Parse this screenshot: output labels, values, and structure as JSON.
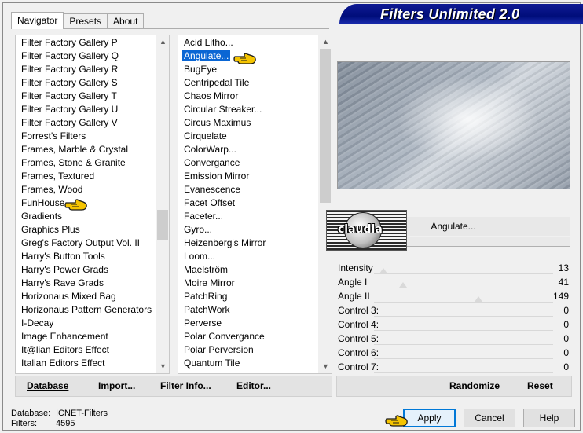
{
  "tabs": [
    {
      "label": "Navigator",
      "active": true
    },
    {
      "label": "Presets",
      "active": false
    },
    {
      "label": "About",
      "active": false
    }
  ],
  "title": "Filters Unlimited 2.0",
  "categories": {
    "items": [
      "Filter Factory Gallery P",
      "Filter Factory Gallery Q",
      "Filter Factory Gallery R",
      "Filter Factory Gallery S",
      "Filter Factory Gallery T",
      "Filter Factory Gallery U",
      "Filter Factory Gallery V",
      "Forrest's Filters",
      "Frames, Marble & Crystal",
      "Frames, Stone & Granite",
      "Frames, Textured",
      "Frames, Wood",
      "FunHouse",
      "Gradients",
      "Graphics Plus",
      "Greg's Factory Output Vol. II",
      "Harry's Button Tools",
      "Harry's Power Grads",
      "Harry's Rave Grads",
      "Horizonaus Mixed Bag",
      "Horizonaus Pattern Generators",
      "I-Decay",
      "Image Enhancement",
      "It@lian Editors Effect",
      "Italian Editors Effect"
    ],
    "pointed": "FunHouse",
    "scroll_fraction": 0.5
  },
  "filters": {
    "items": [
      "Acid Litho...",
      "Angulate...",
      "BugEye",
      "Centripedal Tile",
      "Chaos Mirror",
      "Circular Streaker...",
      "Circus Maximus",
      "Cirquelate",
      "ColorWarp...",
      "Convergance",
      "Emission Mirror",
      "Evanescence",
      "Facet Offset",
      "Faceter...",
      "Gyro...",
      "Heizenberg's Mirror",
      "Loom...",
      "Maelström",
      "Moire Mirror",
      "PatchRing",
      "PatchWork",
      "Perverse",
      "Polar Convergance",
      "Polar Perversion",
      "Quantum Tile"
    ],
    "selected": "Angulate...",
    "scroll_fraction": 0.0
  },
  "logo_text": "claudia",
  "current_filter": "Angulate...",
  "controls": [
    {
      "label": "Intensity",
      "value": "13",
      "fraction": 0.051
    },
    {
      "label": "Angle I",
      "value": "41",
      "fraction": 0.161
    },
    {
      "label": "Angle II",
      "value": "149",
      "fraction": 0.584
    },
    {
      "label": "Control 3:",
      "value": "0",
      "fraction": 0
    },
    {
      "label": "Control 4:",
      "value": "0",
      "fraction": 0
    },
    {
      "label": "Control 5:",
      "value": "0",
      "fraction": 0
    },
    {
      "label": "Control 6:",
      "value": "0",
      "fraction": 0
    },
    {
      "label": "Control 7:",
      "value": "0",
      "fraction": 0
    }
  ],
  "left_bar": {
    "database": "Database",
    "import": "Import...",
    "filter_info": "Filter Info...",
    "editor": "Editor..."
  },
  "right_bar": {
    "randomize": "Randomize",
    "reset": "Reset"
  },
  "status": {
    "database_label": "Database:",
    "database_value": "ICNET-Filters",
    "filters_label": "Filters:",
    "filters_value": "4595"
  },
  "buttons": {
    "apply": "Apply",
    "cancel": "Cancel",
    "help": "Help"
  },
  "colors": {
    "selection": "#0a66d4",
    "banner": "#000d7a",
    "pointer": "#f5c400"
  }
}
